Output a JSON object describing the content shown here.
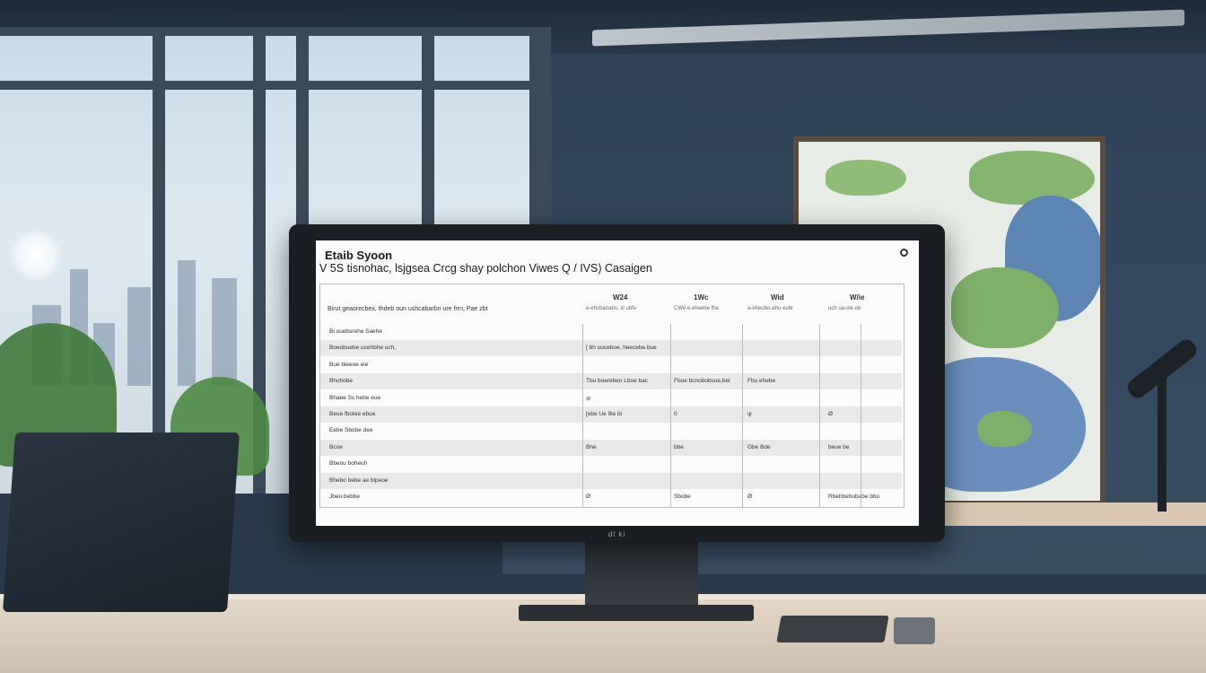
{
  "monitor": {
    "brand": "dl ki"
  },
  "screen": {
    "title": "Etaib Syoon",
    "subtitle": "V 5S tisnohac, lsjgsea Crcg shay polchon Viwes Q / IVS) Casaigen",
    "header_left": "Birut geaorecbex, thdeb oun ushcabarbn ure frrn, Pae zbt",
    "columns": [
      {
        "head": "W24",
        "sub": "e-ehcbaoabn, sl ubfe"
      },
      {
        "head": "1Wc",
        "sub": "CWe e.eheebe fhe"
      },
      {
        "head": "Wid",
        "sub": "a-eheubo-ahu eubr"
      },
      {
        "head": "W/ie",
        "sub": "uch ua-ole eb"
      }
    ],
    "rows": [
      {
        "label": "Bi ouebsrehe Saehe",
        "cells": [
          "",
          "",
          "",
          ""
        ]
      },
      {
        "label": "Boeobuebe ucehbhe uch,",
        "cells": [
          "[ bh uuceboe, heecebe.bue",
          "",
          "",
          ""
        ]
      },
      {
        "label": "Bue bleeoe eie",
        "cells": [
          "",
          "",
          "",
          ""
        ]
      },
      {
        "label": "Bhohobe",
        "cells": [
          "Tbu boerebeo Lboe bac",
          "Fboe bcnobobsoe,bei",
          "Fbu ehebe",
          ""
        ]
      },
      {
        "label": "Bhaee Ss hebe eue",
        "cells": [
          "⊘",
          "",
          "",
          ""
        ]
      },
      {
        "label": "Beue fbotee ebue",
        "cells": [
          "[ebe Ue 9ie bi",
          "0",
          "ψ",
          "Ø"
        ]
      },
      {
        "label": "Eebe Sbobe dee",
        "cells": [
          "",
          "",
          "",
          ""
        ]
      },
      {
        "label": "Bcoe",
        "cells": [
          "Bhe",
          "bbe",
          "Gbe Bde",
          "beue be"
        ]
      },
      {
        "label": "Bbeou boheuh",
        "cells": [
          "",
          "",
          "",
          ""
        ]
      },
      {
        "label": "Bhebo bebe ae blpeoe",
        "cells": [
          "",
          "",
          "",
          ""
        ]
      },
      {
        "label": "Jbeo bebbe",
        "cells": [
          "Ø",
          "Sbobe",
          "Ø",
          "Rbehbebubabe bbu"
        ]
      }
    ]
  },
  "colors": {
    "wall": "#34495f",
    "screen_bg": "#fbfbfb",
    "monitor_bezel": "#1a1d21",
    "desk": "#e3d7c8",
    "board_green": "#7fb06a",
    "board_blue": "#5d86b5"
  }
}
